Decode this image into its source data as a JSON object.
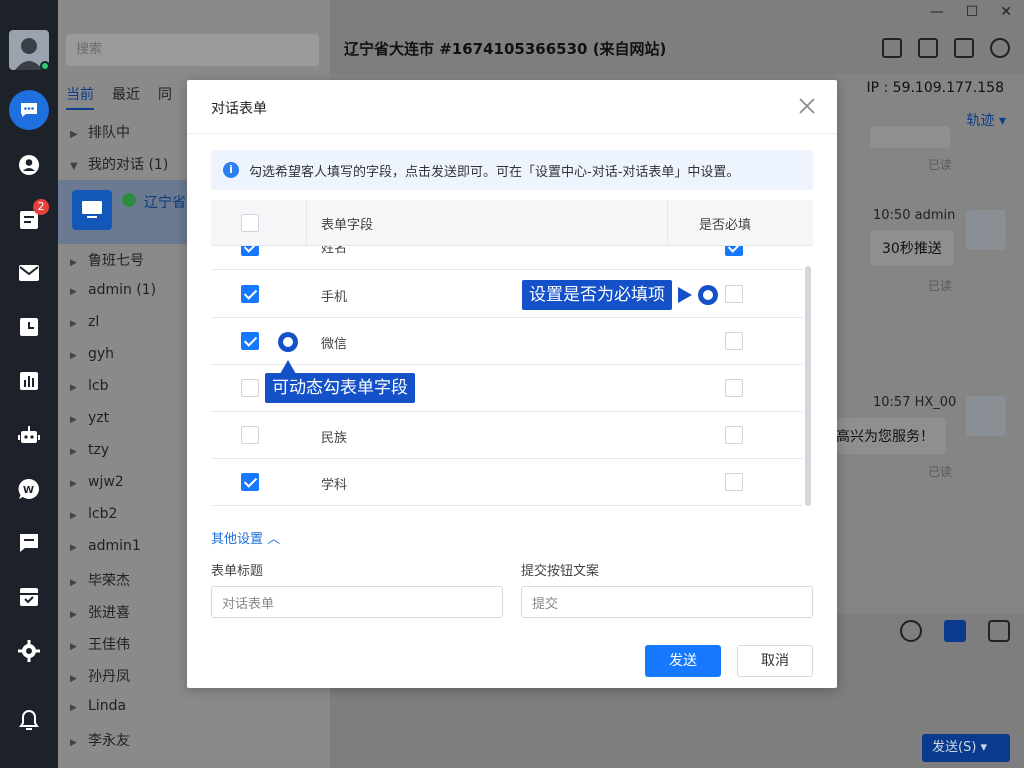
{
  "contacts": {
    "search_placeholder": "搜索",
    "tabs": [
      "当前",
      "最近",
      "同"
    ],
    "groups": [
      {
        "label": "排队中"
      },
      {
        "label": "我的对话 (1)"
      }
    ],
    "active_conversation": "辽宁省",
    "nav_badge": "2",
    "items": [
      "鲁班七号",
      "admin  (1)",
      "zl",
      "gyh",
      "lcb",
      "yzt",
      "tzy",
      "wjw2",
      "lcb2",
      "admin1",
      "毕荣杰",
      "张进喜",
      "王佳伟",
      "孙丹凤",
      "Linda",
      "李永友"
    ]
  },
  "chat": {
    "title": "辽宁省大连市 #1674105366530 (来自网站)",
    "ip": "IP : 59.109.177.158",
    "track": "轨迹",
    "messages": [
      {
        "time": "10:50",
        "sender": "admin",
        "text": "30秒推送",
        "status": "已读"
      },
      {
        "time": "10:57",
        "sender": "HX_00",
        "text": "很高兴为您服务！",
        "status": "已读"
      }
    ],
    "read_top": "已读",
    "read_2": "已读",
    "send_label": "发送(S)"
  },
  "modal": {
    "title": "对话表单",
    "info": "勾选希望客人填写的字段，点击发送即可。可在「设置中心-对话-对话表单」中设置。",
    "col_field": "表单字段",
    "col_required": "是否必填",
    "partial_row": "姓名",
    "rows": [
      {
        "label": "手机",
        "checked": true,
        "required": false
      },
      {
        "label": "微信",
        "checked": true,
        "required": false
      },
      {
        "label": "",
        "checked": false,
        "required": false
      },
      {
        "label": "民族",
        "checked": false,
        "required": false
      },
      {
        "label": "学科",
        "checked": true,
        "required": false
      }
    ],
    "more_settings": "其他设置",
    "form_title_label": "表单标题",
    "form_title_value": "对话表单",
    "submit_label": "提交按钮文案",
    "submit_value": "提交",
    "send": "发送",
    "cancel": "取消"
  },
  "annotations": {
    "required_tip": "设置是否为必填项",
    "dynamic_tip": "可动态勾表单字段"
  },
  "colors": {
    "primary": "#1677ff",
    "annotation": "#1450c8",
    "nav_bg": "#1d2129"
  }
}
